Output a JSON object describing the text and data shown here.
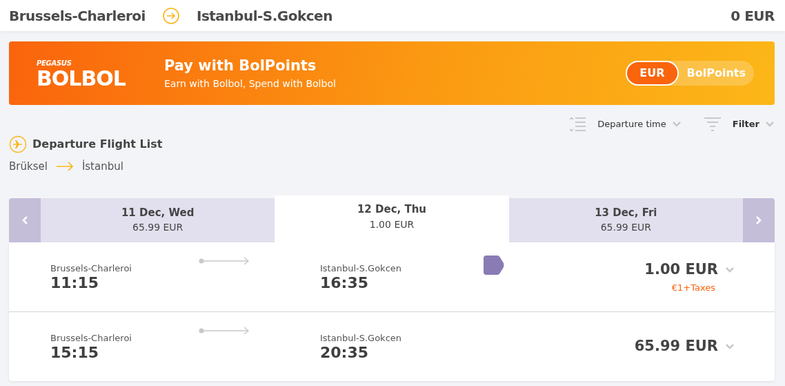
{
  "header": {
    "origin": "Brussels-Charleroi",
    "destination": "Istanbul-S.Gokcen",
    "total": "0 EUR"
  },
  "banner": {
    "logo_brand": "PEGASUS",
    "logo_name": "BOLBOL",
    "title": "Pay with BolPoints",
    "subtitle": "Earn with Bolbol, Spend with Bolbol",
    "currency_options": [
      {
        "label": "EUR",
        "selected": true
      },
      {
        "label": "BolPoints",
        "selected": false
      }
    ]
  },
  "sort": {
    "label": "Departure time"
  },
  "filter": {
    "label": "Filter"
  },
  "section": {
    "title": "Departure Flight List",
    "from": "Brüksel",
    "to": "İstanbul"
  },
  "dates": [
    {
      "date": "11 Dec, Wed",
      "price": "65.99 EUR",
      "selected": false
    },
    {
      "date": "12 Dec, Thu",
      "price": "1.00 EUR",
      "selected": true
    },
    {
      "date": "13 Dec, Fri",
      "price": "65.99 EUR",
      "selected": false
    }
  ],
  "flights": [
    {
      "dep_airport": "Brussels-Charleroi",
      "dep_time": "11:15",
      "arr_airport": "Istanbul-S.Gokcen",
      "arr_time": "16:35",
      "promo": true,
      "price": "1.00 EUR",
      "note": "€1+Taxes"
    },
    {
      "dep_airport": "Brussels-Charleroi",
      "dep_time": "15:15",
      "arr_airport": "Istanbul-S.Gokcen",
      "arr_time": "20:35",
      "promo": false,
      "price": "65.99 EUR"
    }
  ]
}
